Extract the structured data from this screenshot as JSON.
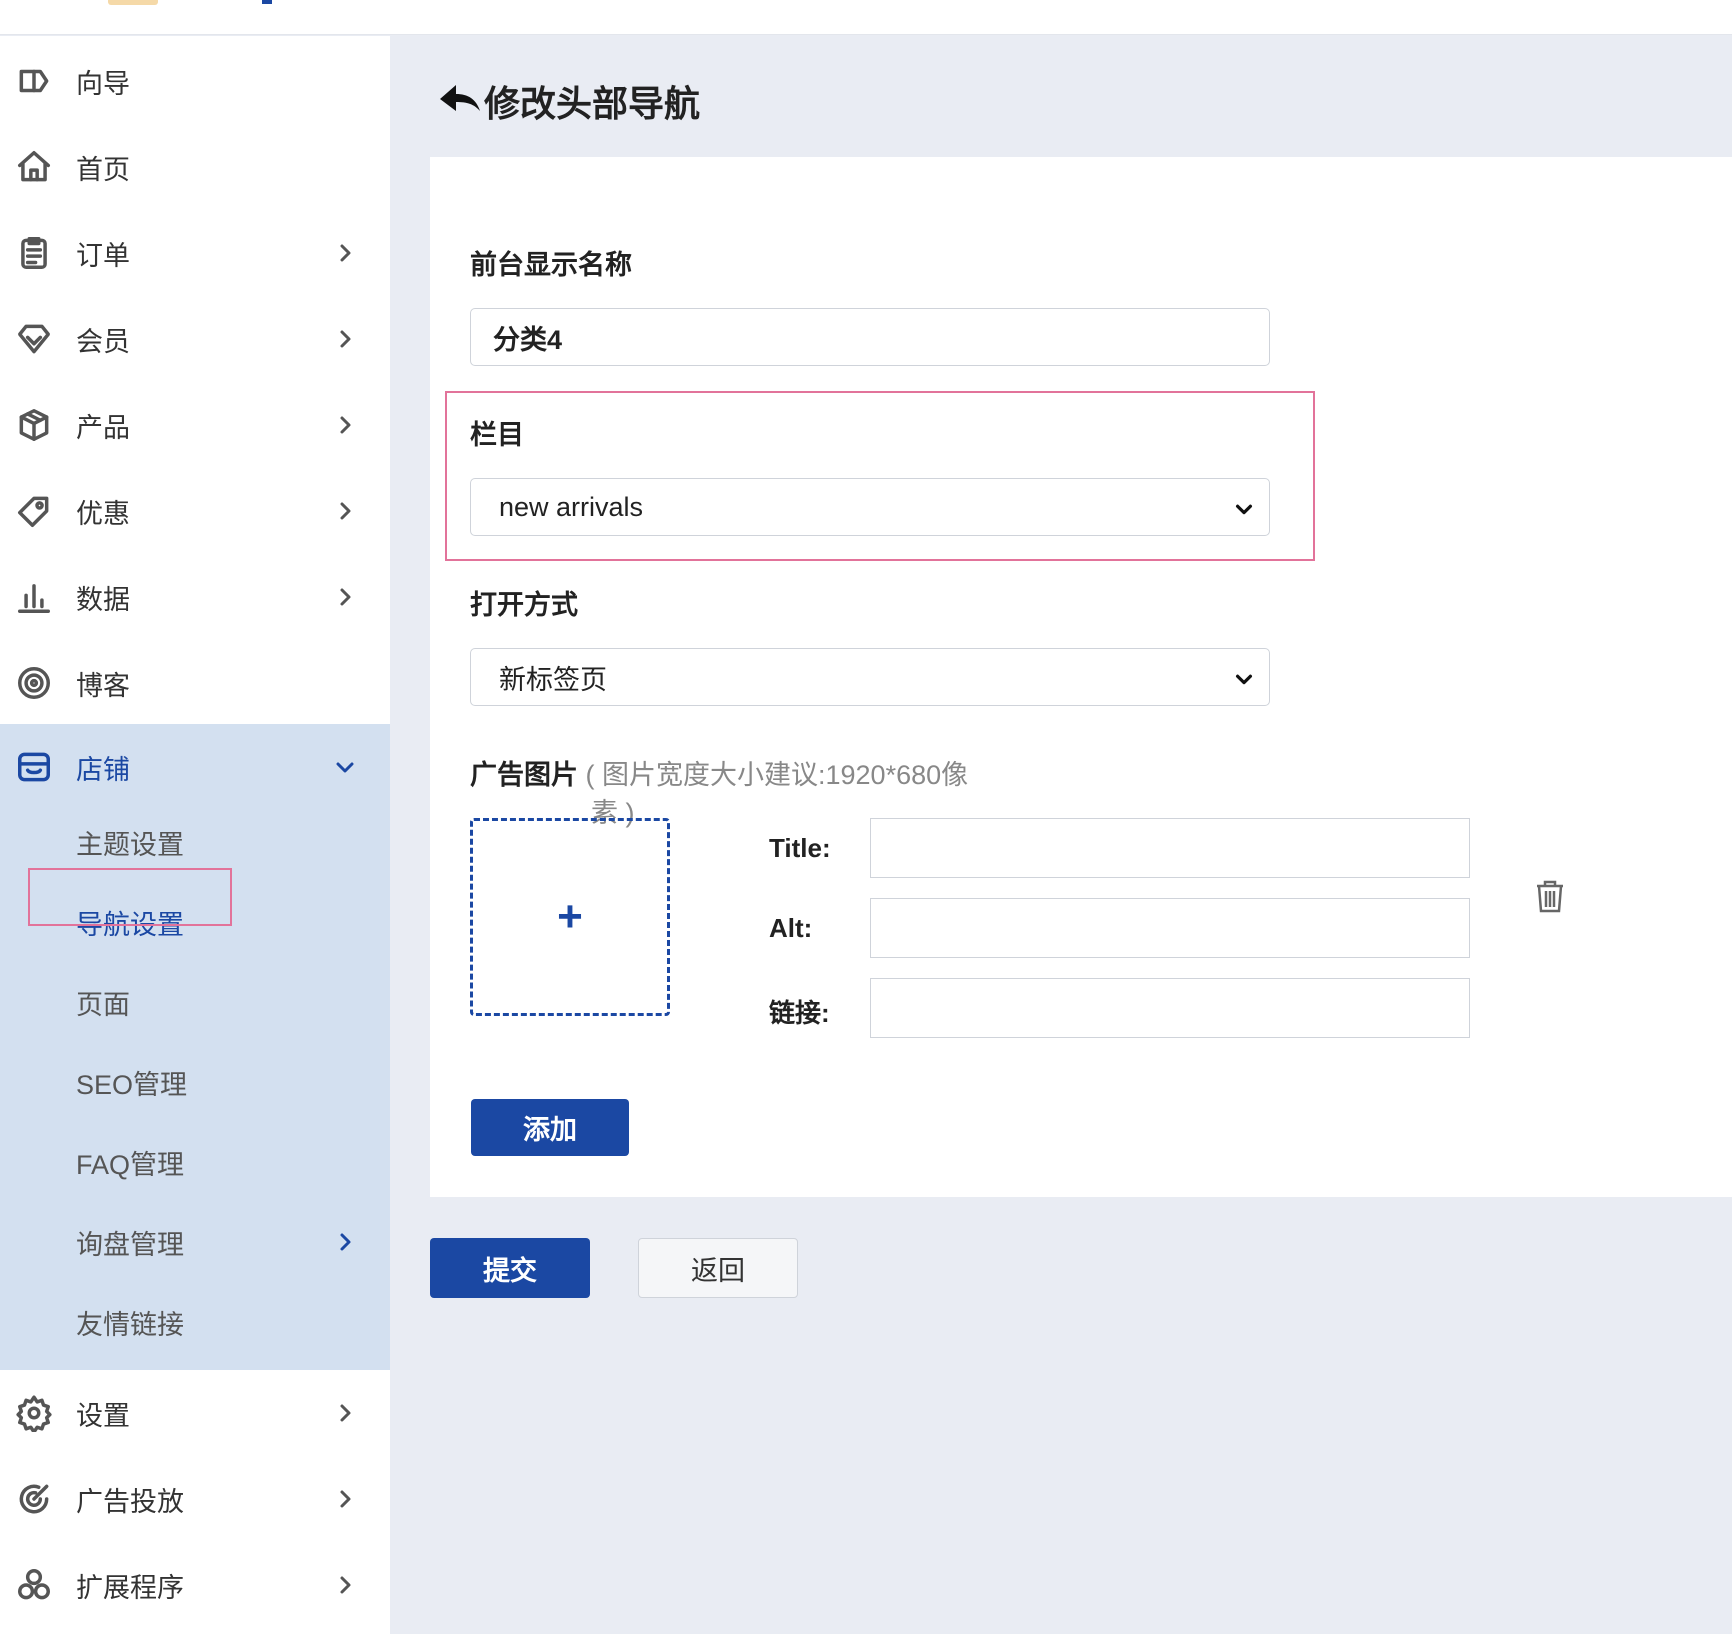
{
  "sidebar": {
    "items": [
      {
        "label": "向导",
        "icon": "guide-icon"
      },
      {
        "label": "首页",
        "icon": "home-icon"
      },
      {
        "label": "订单",
        "icon": "clipboard-icon"
      },
      {
        "label": "会员",
        "icon": "diamond-icon"
      },
      {
        "label": "产品",
        "icon": "box-icon"
      },
      {
        "label": "优惠",
        "icon": "tag-icon"
      },
      {
        "label": "数据",
        "icon": "bar-chart-icon"
      },
      {
        "label": "博客",
        "icon": "target-icon"
      }
    ],
    "store": {
      "label": "店铺",
      "icon": "store-icon",
      "sub_items": [
        "主题设置",
        "导航设置",
        "页面",
        "SEO管理",
        "FAQ管理",
        "询盘管理",
        "友情链接"
      ]
    },
    "bottom_items": [
      {
        "label": "设置",
        "icon": "gear-icon"
      },
      {
        "label": "广告投放",
        "icon": "ad-target-icon"
      },
      {
        "label": "扩展程序",
        "icon": "extensions-icon"
      }
    ]
  },
  "page": {
    "title": "修改头部导航"
  },
  "form": {
    "display_name_label": "前台显示名称",
    "display_name_value": "分类4",
    "column_label": "栏目",
    "column_value": "new arrivals",
    "open_mode_label": "打开方式",
    "open_mode_value": "新标签页",
    "ad_image_label": "广告图片",
    "ad_image_hint_line1": "( 图片宽度大小建议:1920*680像",
    "ad_image_hint_line2": "素 )",
    "upload_plus": "+",
    "title_label": "Title:",
    "alt_label": "Alt:",
    "link_label": "链接:",
    "add_button": "添加"
  },
  "actions": {
    "submit": "提交",
    "back": "返回"
  },
  "colors": {
    "primary": "#1b48a3",
    "highlight": "#e2739a",
    "sidebar_active_bg": "#d3e0f0",
    "page_bg": "#e9ecf3"
  }
}
